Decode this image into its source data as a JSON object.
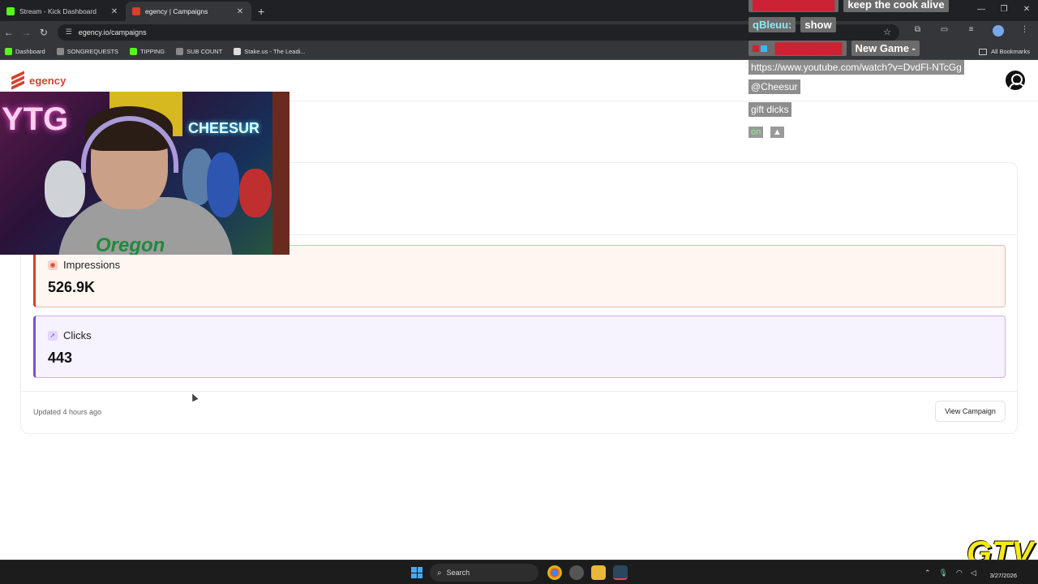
{
  "browser": {
    "tabs": [
      {
        "title": "Stream - Kick Dashboard",
        "active": false
      },
      {
        "title": "egency | Campaigns",
        "active": true
      }
    ],
    "url": "egency.io/campaigns",
    "bookmarks": [
      {
        "label": "Dashboard",
        "color": "#53fc18"
      },
      {
        "label": "SONGREQUESTS",
        "color": "#8a8a8a"
      },
      {
        "label": "TIPPING",
        "color": "#53fc18"
      },
      {
        "label": "SUB COUNT",
        "color": "#8a8a8a"
      },
      {
        "label": "Stake.us - The Leadi...",
        "color": "#dddddd"
      }
    ],
    "all_bookmarks": "All Bookmarks"
  },
  "app": {
    "brand": "egency",
    "brand_color": "#d9412b"
  },
  "campaign": {
    "metrics": {
      "impressions": {
        "label": "Impressions",
        "value": "526.9K"
      },
      "clicks": {
        "label": "Clicks",
        "value": "443"
      }
    },
    "updated": "Updated 4 hours ago",
    "view_button": "View Campaign"
  },
  "stream_overlay": {
    "webcam_sign_left": "YTG",
    "webcam_sign_right": "CHEESUR",
    "webcam_shirt": "Oregon",
    "chat": [
      {
        "user": "",
        "message": "keep the cook alive"
      },
      {
        "user": "qBleuu:",
        "message": "show"
      },
      {
        "user": "",
        "message": "New Game -"
      },
      {
        "link": "https://www.youtube.com/watch?v=DvdFl-NTcGg"
      },
      {
        "link": "@Cheesur"
      },
      {
        "link": "gift dicks"
      },
      {
        "link": "on"
      }
    ],
    "channel_logo": "GTV"
  },
  "taskbar": {
    "search": "Search",
    "date": "3/27/2026"
  }
}
